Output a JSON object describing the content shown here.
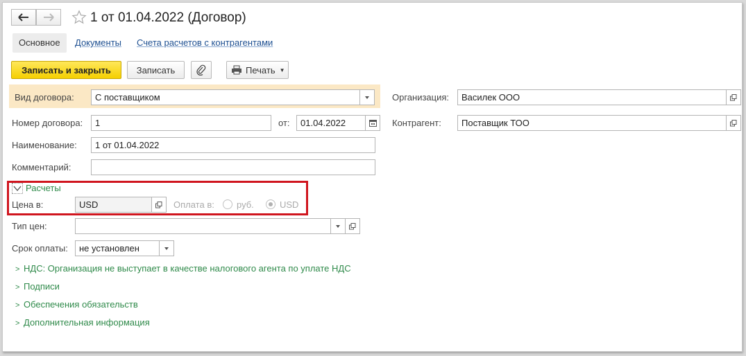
{
  "window": {
    "title": "1 от 01.04.2022 (Договор)"
  },
  "tabs": [
    {
      "label": "Основное",
      "active": true
    },
    {
      "label": "Документы",
      "active": false
    },
    {
      "label": "Счета расчетов с контрагентами",
      "active": false
    }
  ],
  "toolbar": {
    "save_close": "Записать и закрыть",
    "save": "Записать",
    "print": "Печать"
  },
  "form": {
    "contract_type": {
      "label": "Вид договора:",
      "value": "С поставщиком"
    },
    "organization": {
      "label": "Организация:",
      "value": "Василек ООО"
    },
    "contract_number": {
      "label": "Номер договора:",
      "value": "1"
    },
    "date": {
      "label": "от:",
      "value": "01.04.2022"
    },
    "counterparty": {
      "label": "Контрагент:",
      "value": "Поставщик ТОО"
    },
    "name": {
      "label": "Наименование:",
      "value": "1 от 01.04.2022"
    },
    "comment": {
      "label": "Комментарий:",
      "value": ""
    },
    "settlements": {
      "header": "Расчеты",
      "price_label": "Цена в:",
      "price_value": "USD",
      "payment_label": "Оплата в:",
      "option_rub": "руб.",
      "option_usd": "USD",
      "selected": "USD"
    },
    "price_type": {
      "label": "Тип цен:",
      "value": ""
    },
    "payment_term": {
      "label": "Срок оплаты:",
      "value": "не установлен"
    }
  },
  "sections": [
    "НДС: Организация не выступает в качестве налогового агента по уплате НДС",
    "Подписи",
    "Обеспечения обязательств",
    "Дополнительная информация"
  ],
  "colors": {
    "primary_button": "#f5d000",
    "section_green": "#2f8a4a",
    "highlight_box": "#d0151e",
    "focus_row": "#fbe8c5"
  }
}
